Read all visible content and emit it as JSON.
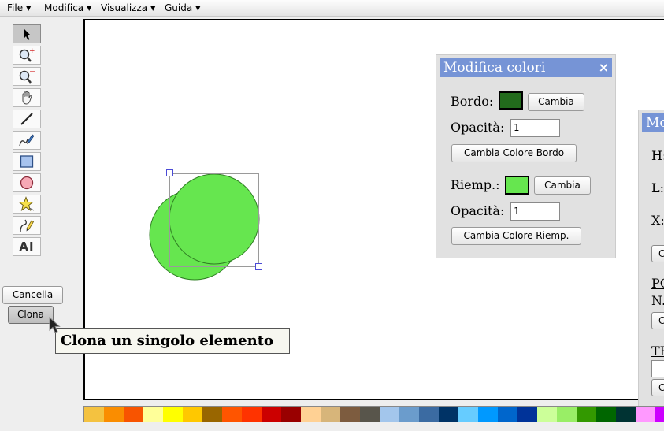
{
  "menu": [
    {
      "id": "file",
      "label": "File"
    },
    {
      "id": "modifica",
      "label": "Modifica"
    },
    {
      "id": "visualizza",
      "label": "Visualizza"
    },
    {
      "id": "guida",
      "label": "Guida"
    }
  ],
  "toolbar": {
    "tools": [
      {
        "name": "select-tool-icon",
        "selected": true
      },
      {
        "name": "zoom-in-tool-icon",
        "selected": false
      },
      {
        "name": "zoom-out-tool-icon",
        "selected": false
      },
      {
        "name": "pan-hand-tool-icon",
        "selected": false
      },
      {
        "name": "line-tool-icon",
        "selected": false
      },
      {
        "name": "pen-tool-icon",
        "selected": false
      },
      {
        "name": "rectangle-tool-icon",
        "selected": false
      },
      {
        "name": "circle-tool-icon",
        "selected": false
      },
      {
        "name": "star-shape-tool-icon",
        "selected": false
      },
      {
        "name": "path-edit-tool-icon",
        "selected": false
      },
      {
        "name": "text-tool-icon",
        "selected": false
      }
    ],
    "text_tool_glyph": "AI",
    "cancel_label": "Cancella",
    "clone_label": "Clona"
  },
  "tooltip": "Clona un singolo elemento",
  "color_dialog": {
    "title": "Modifica colori",
    "close_icon": "×",
    "stroke_label": "Bordo:",
    "stroke_color": "#226b1c",
    "change_label": "Cambia",
    "opacity_label": "Opacità:",
    "stroke_opacity": "1",
    "change_stroke_button": "Cambia Colore Bordo",
    "fill_label": "Riemp.:",
    "fill_color": "#66e64f",
    "fill_opacity": "1",
    "change_fill_button": "Cambia Colore Riemp."
  },
  "second_dialog": {
    "title": "Mo",
    "labels": [
      "H:",
      "L:",
      "X:"
    ],
    "button_fragments": [
      "C",
      "C",
      "C"
    ],
    "section_po": "PO",
    "section_n": "N.",
    "section_tr": "TR"
  },
  "drawing": {
    "circle_fill": "#66e64f",
    "circle_stroke": "#2e7d22"
  },
  "palette": [
    "#f4c240",
    "#fa8d00",
    "#f85400",
    "#ffff99",
    "#ffff00",
    "#ffc800",
    "#996600",
    "#ff5500",
    "#ff3300",
    "#cc0000",
    "#990000",
    "#ffd194",
    "#d7b57a",
    "#7d5c3f",
    "#58554b",
    "#a3c6ec",
    "#6b9ccc",
    "#3b6ba2",
    "#003366",
    "#66ccff",
    "#0099ff",
    "#0066cc",
    "#003399",
    "#ccff99",
    "#99ee66",
    "#339900",
    "#006600",
    "#003333",
    "#ff99ff",
    "#cc00ff"
  ]
}
